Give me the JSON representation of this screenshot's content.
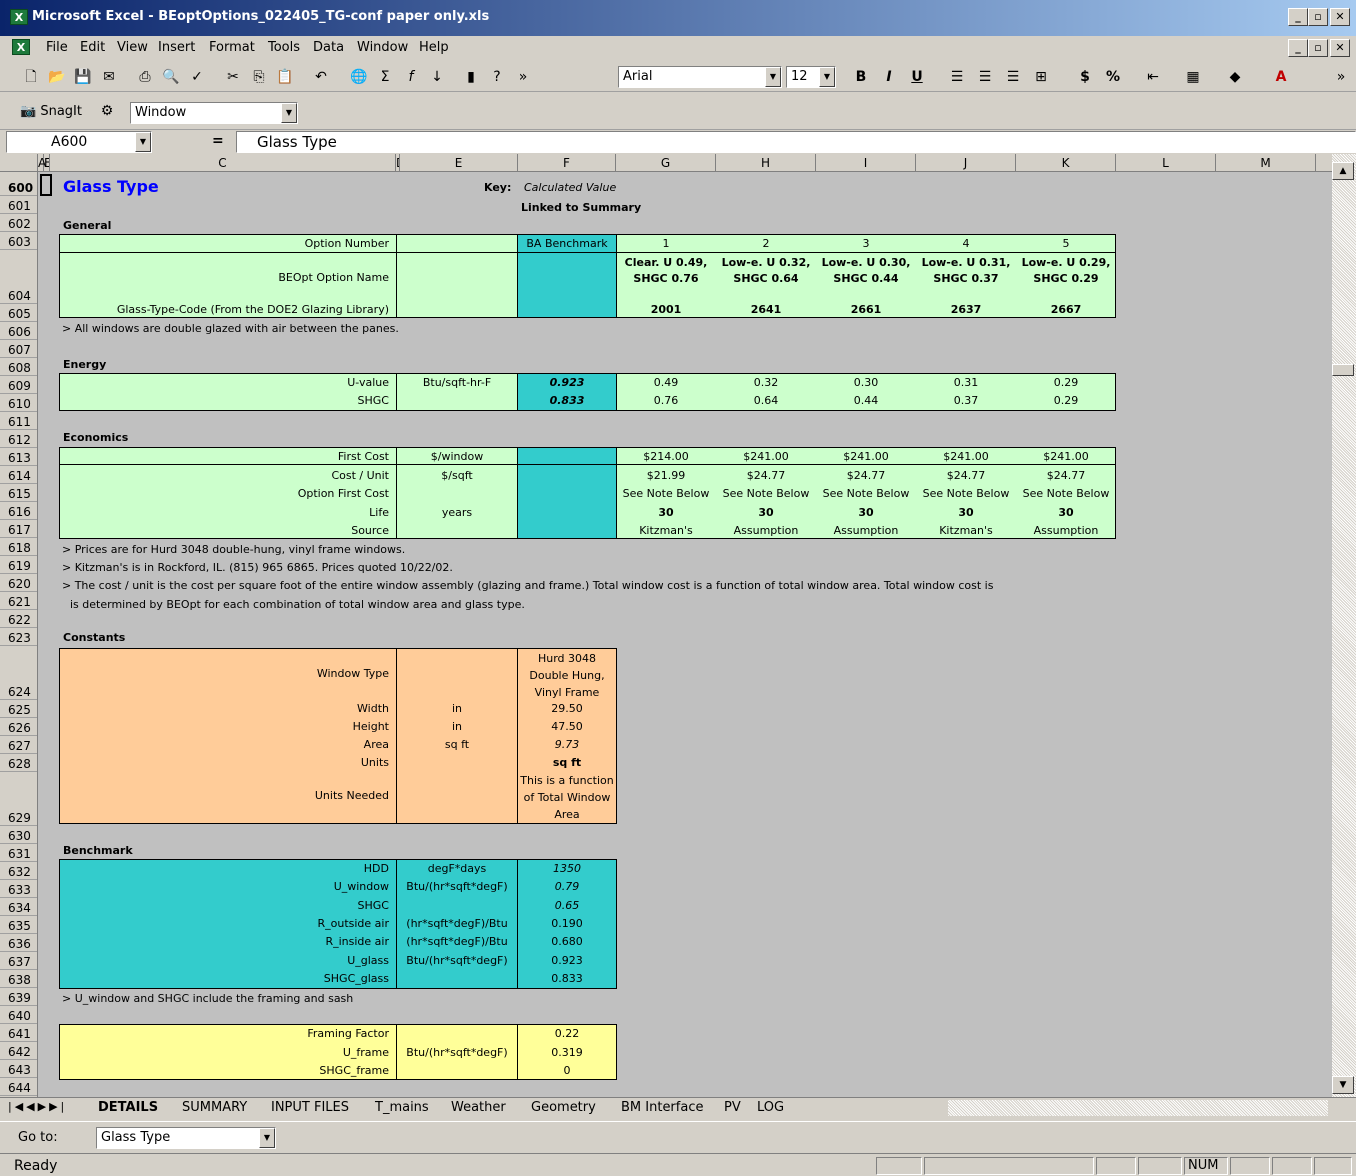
{
  "window": {
    "title": "Microsoft Excel - BEoptOptions_022405_TG-conf paper only.xls"
  },
  "menu": [
    "File",
    "Edit",
    "View",
    "Insert",
    "Format",
    "Tools",
    "Data",
    "Window",
    "Help"
  ],
  "toolbar": {
    "font": "Arial",
    "size": "12"
  },
  "snagit": {
    "label": "SnagIt",
    "capture": "Window"
  },
  "formula": {
    "cellref": "A600",
    "eq": "=",
    "value": "Glass Type"
  },
  "columns": [
    "A",
    "E",
    "C",
    "D",
    "E",
    "F",
    "G",
    "H",
    "I",
    "J",
    "K",
    "L",
    "M"
  ],
  "rows": [
    "600",
    "601",
    "602",
    "603",
    "604",
    "605",
    "606",
    "607",
    "608",
    "609",
    "610",
    "611",
    "612",
    "613",
    "614",
    "615",
    "616",
    "617",
    "618",
    "619",
    "620",
    "621",
    "622",
    "623",
    "624",
    "625",
    "626",
    "627",
    "628",
    "629",
    "630",
    "631",
    "632",
    "633",
    "634",
    "635",
    "636",
    "637",
    "638",
    "639",
    "640",
    "641",
    "642",
    "643",
    "644"
  ],
  "sheet": {
    "title": "Glass Type",
    "key_label": "Key:",
    "key_calc": "Calculated Value",
    "key_linked": "Linked to Summary",
    "general": {
      "heading": "General",
      "labels": [
        "Option Number",
        "BEOpt Option Name",
        "Glass-Type-Code (From the DOE2 Glazing Library)"
      ],
      "benchmark": "BA Benchmark",
      "options": [
        {
          "num": "1",
          "name": "Clear. U 0.49, SHGC 0.76",
          "code": "2001"
        },
        {
          "num": "2",
          "name": "Low-e. U 0.32, SHGC 0.64",
          "code": "2641"
        },
        {
          "num": "3",
          "name": "Low-e. U 0.30, SHGC 0.44",
          "code": "2661"
        },
        {
          "num": "4",
          "name": "Low-e. U 0.31, SHGC 0.37",
          "code": "2637"
        },
        {
          "num": "5",
          "name": "Low-e. U 0.29, SHGC 0.29",
          "code": "2667"
        }
      ],
      "note": "> All windows are double glazed with air between the panes."
    },
    "energy": {
      "heading": "Energy",
      "rows": [
        {
          "label": "U-value",
          "unit": "Btu/sqft-hr-F",
          "bench": "0.923",
          "vals": [
            "0.49",
            "0.32",
            "0.30",
            "0.31",
            "0.29"
          ]
        },
        {
          "label": "SHGC",
          "unit": "",
          "bench": "0.833",
          "vals": [
            "0.76",
            "0.64",
            "0.44",
            "0.37",
            "0.29"
          ]
        }
      ]
    },
    "economics": {
      "heading": "Economics",
      "rows": [
        {
          "label": "First Cost",
          "unit": "$/window",
          "vals": [
            "$214.00",
            "$241.00",
            "$241.00",
            "$241.00",
            "$241.00"
          ]
        },
        {
          "label": "Cost / Unit",
          "unit": "$/sqft",
          "vals": [
            "$21.99",
            "$24.77",
            "$24.77",
            "$24.77",
            "$24.77"
          ]
        },
        {
          "label": "Option First Cost",
          "unit": "",
          "vals": [
            "See Note Below",
            "See Note Below",
            "See Note Below",
            "See Note Below",
            "See Note Below"
          ]
        },
        {
          "label": "Life",
          "unit": "years",
          "vals": [
            "30",
            "30",
            "30",
            "30",
            "30"
          ]
        },
        {
          "label": "Source",
          "unit": "",
          "vals": [
            "Kitzman's",
            "Assumption",
            "Assumption",
            "Kitzman's",
            "Assumption"
          ]
        }
      ],
      "notes": [
        "> Prices are for Hurd 3048 double-hung, vinyl frame windows.",
        "> Kitzman's is in Rockford, IL. (815) 965 6865. Prices quoted 10/22/02.",
        "> The cost / unit is the cost per square foot of the entire window assembly (glazing and frame.) Total window cost is a function of total window area. Total window cost is",
        "is determined by BEOpt for each combination of total window area and glass type."
      ]
    },
    "constants": {
      "heading": "Constants",
      "rows": [
        {
          "label": "Window Type",
          "unit": "",
          "val": [
            "Hurd 3048",
            "Double Hung,",
            "Vinyl Frame"
          ]
        },
        {
          "label": "Width",
          "unit": "in",
          "val": [
            "29.50"
          ]
        },
        {
          "label": "Height",
          "unit": "in",
          "val": [
            "47.50"
          ]
        },
        {
          "label": "Area",
          "unit": "sq ft",
          "val": [
            "9.73"
          ]
        },
        {
          "label": "Units",
          "unit": "",
          "val": [
            "sq ft"
          ]
        },
        {
          "label": "Units Needed",
          "unit": "",
          "val": [
            "This is a function",
            "of Total Window",
            "Area"
          ]
        }
      ]
    },
    "benchmark": {
      "heading": "Benchmark",
      "rows": [
        {
          "label": "HDD",
          "unit": "degF*days",
          "val": "1350"
        },
        {
          "label": "U_window",
          "unit": "Btu/(hr*sqft*degF)",
          "val": "0.79"
        },
        {
          "label": "SHGC",
          "unit": "",
          "val": "0.65"
        },
        {
          "label": "R_outside air",
          "unit": "(hr*sqft*degF)/Btu",
          "val": "0.190"
        },
        {
          "label": "R_inside air",
          "unit": "(hr*sqft*degF)/Btu",
          "val": "0.680"
        },
        {
          "label": "U_glass",
          "unit": "Btu/(hr*sqft*degF)",
          "val": "0.923"
        },
        {
          "label": "SHGC_glass",
          "unit": "",
          "val": "0.833"
        }
      ],
      "note": "> U_window and SHGC include the framing and sash"
    },
    "framing": {
      "rows": [
        {
          "label": "Framing Factor",
          "unit": "",
          "val": "0.22"
        },
        {
          "label": "U_frame",
          "unit": "Btu/(hr*sqft*degF)",
          "val": "0.319"
        },
        {
          "label": "SHGC_frame",
          "unit": "",
          "val": "0"
        }
      ]
    }
  },
  "tabs": [
    "DETAILS",
    "SUMMARY",
    "INPUT FILES",
    "T_mains",
    "Weather",
    "Geometry",
    "BM Interface",
    "PV",
    "LOG"
  ],
  "goto": {
    "label": "Go to:",
    "value": "Glass Type"
  },
  "status": {
    "ready": "Ready",
    "num": "NUM"
  },
  "colors": {
    "green": "#ccffcc",
    "teal": "#33cccc",
    "peach": "#ffcc99",
    "yellow": "#ffff99",
    "titleblue": "#0000ff"
  }
}
